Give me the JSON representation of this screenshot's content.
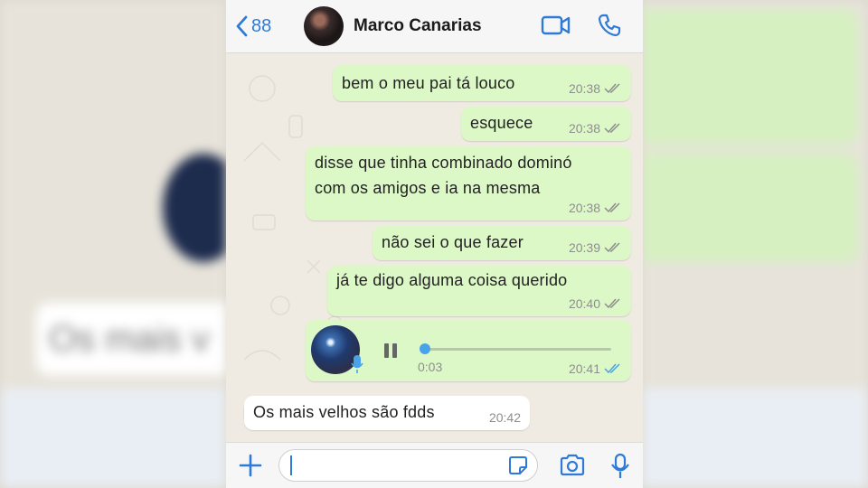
{
  "header": {
    "back_count": "88",
    "contact_name": "Marco Canarias"
  },
  "messages": [
    {
      "text": "bem o meu pai tá louco",
      "time": "20:38",
      "dir": "out"
    },
    {
      "text": "esquece",
      "time": "20:38",
      "dir": "out"
    },
    {
      "line1": "disse que tinha combinado dominó",
      "line2": "com os amigos e ia na mesma",
      "time": "20:38",
      "dir": "out"
    },
    {
      "text": "não sei o que fazer",
      "time": "20:39",
      "dir": "out"
    },
    {
      "text": "já te digo alguma coisa querido",
      "time": "20:40",
      "dir": "out"
    },
    {
      "duration": "0:03",
      "time": "20:41",
      "dir": "out",
      "progress": 0.0
    },
    {
      "text": "Os mais velhos são fdds",
      "time": "20:42",
      "dir": "in"
    }
  ],
  "background": {
    "blurred_preview_text": "Os mais v"
  },
  "colors": {
    "accent": "#2d7bd6",
    "outgoing_bubble": "#dcf8c6",
    "incoming_bubble": "#ffffff",
    "read_tick": "#4aa3e8",
    "delivered_tick": "#8e8e8e"
  },
  "icons": [
    "chevron-left-icon",
    "video-call-icon",
    "phone-icon",
    "pause-icon",
    "mic-icon",
    "plus-icon",
    "sticker-icon",
    "camera-icon"
  ]
}
